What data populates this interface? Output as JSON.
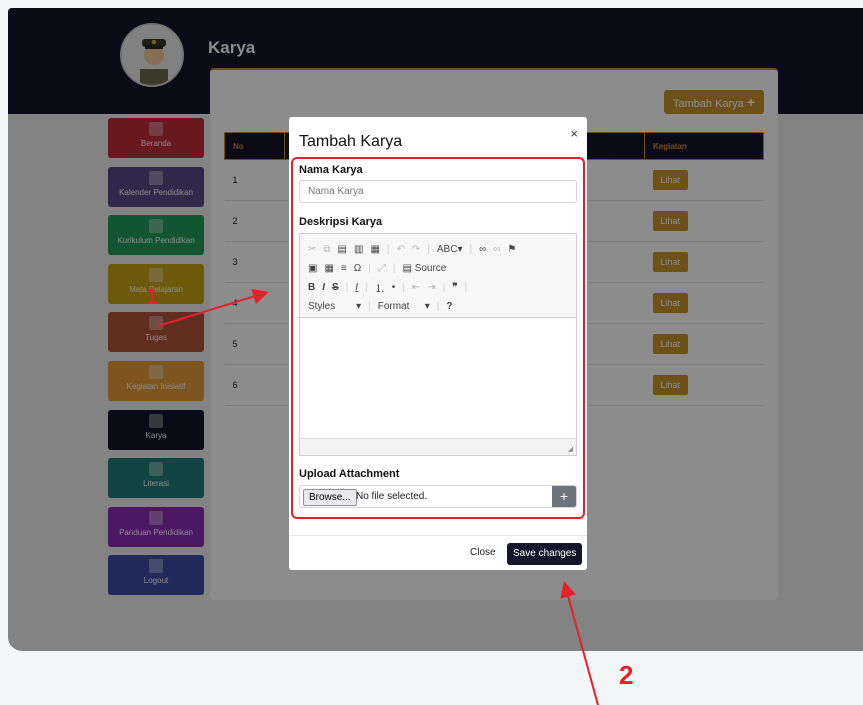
{
  "app": {
    "title": "Karya",
    "add_button": "Tambah Karya",
    "add_icon": "plus-icon"
  },
  "sidebar": {
    "items": [
      {
        "label": "Beranda",
        "color": "#c12b3a"
      },
      {
        "label": "Kalender Pendidikan",
        "color": "#5c4a86"
      },
      {
        "label": "Kurikulum Pendidikan",
        "color": "#1f9c5a"
      },
      {
        "label": "Mata Pelajaran",
        "color": "#c7a417"
      },
      {
        "label": "Tugas",
        "color": "#b3523c"
      },
      {
        "label": "Kegiatan Inisiatif",
        "color": "#e29c3a"
      },
      {
        "label": "Karya",
        "color": "#14142a"
      },
      {
        "label": "Literasi",
        "color": "#1f7f7a"
      },
      {
        "label": "Panduan Pendidikan",
        "color": "#8a2bb5"
      },
      {
        "label": "Logout",
        "color": "#3d4ea4"
      }
    ]
  },
  "table": {
    "columns": [
      "No",
      "Kegiatan"
    ],
    "rows": [
      {
        "no": "1",
        "action": "Lihat"
      },
      {
        "no": "2",
        "action": "Lihat"
      },
      {
        "no": "3",
        "action": "Lihat"
      },
      {
        "no": "4",
        "action": "Lihat"
      },
      {
        "no": "5",
        "action": "Lihat"
      },
      {
        "no": "6",
        "action": "Lihat"
      }
    ]
  },
  "modal": {
    "title": "Tambah Karya",
    "close_glyph": "×",
    "name_label": "Nama Karya",
    "name_placeholder": "Nama Karya",
    "desc_label": "Deskripsi Karya",
    "toolbar_source": "Source",
    "toolbar_styles": "Styles",
    "toolbar_format": "Format",
    "toolbar_help": "?",
    "upload_label": "Upload Attachment",
    "browse_label": "Browse...",
    "no_file_text": "No file selected.",
    "close_label": "Close",
    "save_label": "Save changes"
  },
  "annotations": {
    "step1": "1",
    "step2": "2",
    "color": "#e32128"
  },
  "colors": {
    "navy": "#14142a",
    "gold": "#c9922f",
    "highlight": "#e32128"
  }
}
